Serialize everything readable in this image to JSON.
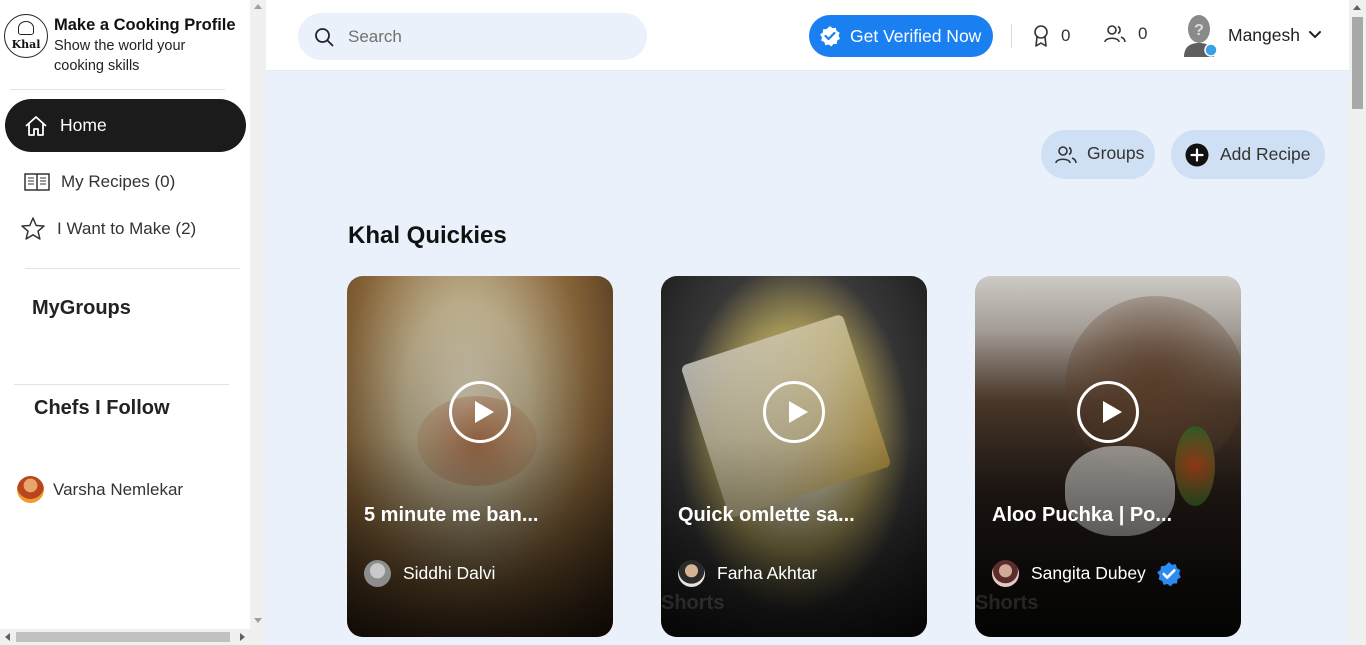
{
  "brand": {
    "logo_text": "Khal",
    "title": "Make a Cooking Profile",
    "subtitle": "Show the world your cooking skills"
  },
  "sidebar": {
    "home_label": "Home",
    "my_recipes_label": "My Recipes (0)",
    "want_to_make_label": "I Want to Make (2)",
    "my_groups_heading": "MyGroups",
    "chefs_heading": "Chefs I Follow",
    "chefs": [
      {
        "name": "Varsha Nemlekar"
      }
    ]
  },
  "topbar": {
    "search_placeholder": "Search",
    "verify_label": "Get Verified Now",
    "badges_count": "0",
    "friends_count": "0",
    "user_name": "Mangesh"
  },
  "actions": {
    "groups_label": "Groups",
    "add_recipe_label": "Add Recipe"
  },
  "section": {
    "title": "Khal Quickies"
  },
  "cards": [
    {
      "title": "5 minute me ban...",
      "author": "Siddhi Dalvi",
      "verified": false,
      "watermark": ""
    },
    {
      "title": "Quick omlette sa...",
      "author": "Farha Akhtar",
      "verified": false,
      "watermark": "Shorts"
    },
    {
      "title": "Aloo Puchka | Po...",
      "author": "Sangita Dubey",
      "verified": true,
      "watermark": "Shorts"
    }
  ],
  "colors": {
    "accent": "#1a7ff0",
    "home_bg": "#1b1b1b",
    "main_bg": "#eaf1fa",
    "pill_bg": "#cfe0f4"
  }
}
